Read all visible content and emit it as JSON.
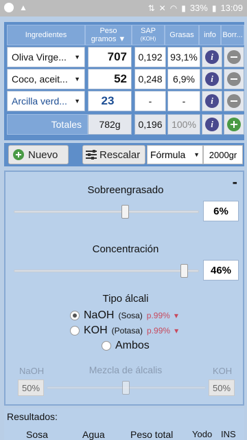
{
  "status": {
    "battery": "33%",
    "time": "13:09"
  },
  "table": {
    "headers": {
      "ingredientes": "Ingredientes",
      "peso": "Peso",
      "gramos": "gramos ▼",
      "sap": "SAP",
      "sap_sub": "(KOH)",
      "grasas": "Grasas",
      "info": "info",
      "borrar": "Borr..."
    },
    "rows": [
      {
        "name": "Oliva Virge...",
        "grams": "707",
        "sap": "0,192",
        "grasas": "93,1%"
      },
      {
        "name": "Coco, aceit...",
        "grams": "52",
        "sap": "0,248",
        "grasas": "6,9%"
      },
      {
        "name": "Arcilla verd...",
        "grams": "23",
        "sap": "-",
        "grasas": "-"
      }
    ],
    "totals": {
      "label": "Totales",
      "grams": "782g",
      "sap": "0,196",
      "grasas": "100%"
    }
  },
  "toolbar": {
    "new_label": "Nuevo",
    "rescale_label": "Rescalar",
    "formula_label": "Fórmula",
    "grams_value": "2000gr"
  },
  "panel": {
    "collapse_glyph": "-",
    "superfat_label": "Sobreengrasado",
    "superfat_value": "6%",
    "superfat_fraction": 0.06,
    "concentration_label": "Concentración",
    "concentration_value": "46%",
    "concentration_fraction": 0.46,
    "alkali_label": "Tipo álcali",
    "naoh_label": "NaOH",
    "naoh_sub": "(Sosa)",
    "naoh_purity": "p.99%",
    "koh_label": "KOH",
    "koh_sub": "(Potasa)",
    "koh_purity": "p.99%",
    "both_label": "Ambos",
    "selected": "NaOH",
    "mix_left": "NaOH",
    "mix_label": "Mezcla de álcalis",
    "mix_right": "KOH",
    "mix_left_value": "50%",
    "mix_right_value": "50%"
  },
  "results": {
    "title": "Resultados:",
    "columns": [
      "Sosa",
      "Agua",
      "Peso total",
      "Yodo",
      "INS"
    ]
  },
  "colors": {
    "panel_blue": "#5e8ec9",
    "header_blue": "#7ea6d8",
    "info_icon": "#4a4a8e",
    "add_green": "#4a9a45"
  }
}
